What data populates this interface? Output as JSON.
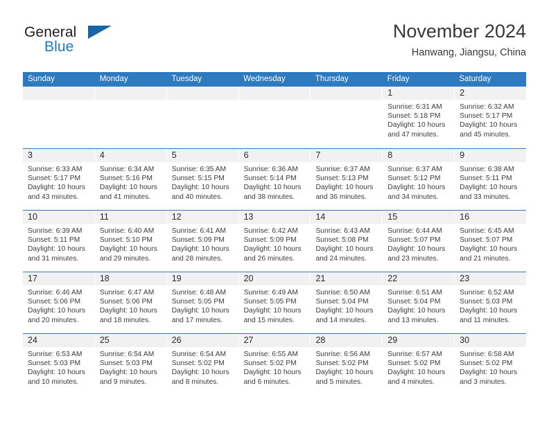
{
  "brand": {
    "word1": "General",
    "word2": "Blue",
    "flag_icon": "triangle-flag-icon",
    "color_dark": "#1c1c1c",
    "color_blue": "#1f78c1",
    "flag_color": "#1565a8"
  },
  "header": {
    "title": "November 2024",
    "subtitle": "Hanwang, Jiangsu, China"
  },
  "theme": {
    "header_bg": "#2d7ac0",
    "daynum_bg": "#f1f1f1",
    "text": "#3a3b3d"
  },
  "weekdays": [
    "Sunday",
    "Monday",
    "Tuesday",
    "Wednesday",
    "Thursday",
    "Friday",
    "Saturday"
  ],
  "weeks": [
    [
      {
        "day": "",
        "lines": []
      },
      {
        "day": "",
        "lines": []
      },
      {
        "day": "",
        "lines": []
      },
      {
        "day": "",
        "lines": []
      },
      {
        "day": "",
        "lines": []
      },
      {
        "day": "1",
        "lines": [
          "Sunrise: 6:31 AM",
          "Sunset: 5:18 PM",
          "Daylight: 10 hours",
          "and 47 minutes."
        ]
      },
      {
        "day": "2",
        "lines": [
          "Sunrise: 6:32 AM",
          "Sunset: 5:17 PM",
          "Daylight: 10 hours",
          "and 45 minutes."
        ]
      }
    ],
    [
      {
        "day": "3",
        "lines": [
          "Sunrise: 6:33 AM",
          "Sunset: 5:17 PM",
          "Daylight: 10 hours",
          "and 43 minutes."
        ]
      },
      {
        "day": "4",
        "lines": [
          "Sunrise: 6:34 AM",
          "Sunset: 5:16 PM",
          "Daylight: 10 hours",
          "and 41 minutes."
        ]
      },
      {
        "day": "5",
        "lines": [
          "Sunrise: 6:35 AM",
          "Sunset: 5:15 PM",
          "Daylight: 10 hours",
          "and 40 minutes."
        ]
      },
      {
        "day": "6",
        "lines": [
          "Sunrise: 6:36 AM",
          "Sunset: 5:14 PM",
          "Daylight: 10 hours",
          "and 38 minutes."
        ]
      },
      {
        "day": "7",
        "lines": [
          "Sunrise: 6:37 AM",
          "Sunset: 5:13 PM",
          "Daylight: 10 hours",
          "and 36 minutes."
        ]
      },
      {
        "day": "8",
        "lines": [
          "Sunrise: 6:37 AM",
          "Sunset: 5:12 PM",
          "Daylight: 10 hours",
          "and 34 minutes."
        ]
      },
      {
        "day": "9",
        "lines": [
          "Sunrise: 6:38 AM",
          "Sunset: 5:11 PM",
          "Daylight: 10 hours",
          "and 33 minutes."
        ]
      }
    ],
    [
      {
        "day": "10",
        "lines": [
          "Sunrise: 6:39 AM",
          "Sunset: 5:11 PM",
          "Daylight: 10 hours",
          "and 31 minutes."
        ]
      },
      {
        "day": "11",
        "lines": [
          "Sunrise: 6:40 AM",
          "Sunset: 5:10 PM",
          "Daylight: 10 hours",
          "and 29 minutes."
        ]
      },
      {
        "day": "12",
        "lines": [
          "Sunrise: 6:41 AM",
          "Sunset: 5:09 PM",
          "Daylight: 10 hours",
          "and 28 minutes."
        ]
      },
      {
        "day": "13",
        "lines": [
          "Sunrise: 6:42 AM",
          "Sunset: 5:09 PM",
          "Daylight: 10 hours",
          "and 26 minutes."
        ]
      },
      {
        "day": "14",
        "lines": [
          "Sunrise: 6:43 AM",
          "Sunset: 5:08 PM",
          "Daylight: 10 hours",
          "and 24 minutes."
        ]
      },
      {
        "day": "15",
        "lines": [
          "Sunrise: 6:44 AM",
          "Sunset: 5:07 PM",
          "Daylight: 10 hours",
          "and 23 minutes."
        ]
      },
      {
        "day": "16",
        "lines": [
          "Sunrise: 6:45 AM",
          "Sunset: 5:07 PM",
          "Daylight: 10 hours",
          "and 21 minutes."
        ]
      }
    ],
    [
      {
        "day": "17",
        "lines": [
          "Sunrise: 6:46 AM",
          "Sunset: 5:06 PM",
          "Daylight: 10 hours",
          "and 20 minutes."
        ]
      },
      {
        "day": "18",
        "lines": [
          "Sunrise: 6:47 AM",
          "Sunset: 5:06 PM",
          "Daylight: 10 hours",
          "and 18 minutes."
        ]
      },
      {
        "day": "19",
        "lines": [
          "Sunrise: 6:48 AM",
          "Sunset: 5:05 PM",
          "Daylight: 10 hours",
          "and 17 minutes."
        ]
      },
      {
        "day": "20",
        "lines": [
          "Sunrise: 6:49 AM",
          "Sunset: 5:05 PM",
          "Daylight: 10 hours",
          "and 15 minutes."
        ]
      },
      {
        "day": "21",
        "lines": [
          "Sunrise: 6:50 AM",
          "Sunset: 5:04 PM",
          "Daylight: 10 hours",
          "and 14 minutes."
        ]
      },
      {
        "day": "22",
        "lines": [
          "Sunrise: 6:51 AM",
          "Sunset: 5:04 PM",
          "Daylight: 10 hours",
          "and 13 minutes."
        ]
      },
      {
        "day": "23",
        "lines": [
          "Sunrise: 6:52 AM",
          "Sunset: 5:03 PM",
          "Daylight: 10 hours",
          "and 11 minutes."
        ]
      }
    ],
    [
      {
        "day": "24",
        "lines": [
          "Sunrise: 6:53 AM",
          "Sunset: 5:03 PM",
          "Daylight: 10 hours",
          "and 10 minutes."
        ]
      },
      {
        "day": "25",
        "lines": [
          "Sunrise: 6:54 AM",
          "Sunset: 5:03 PM",
          "Daylight: 10 hours",
          "and 9 minutes."
        ]
      },
      {
        "day": "26",
        "lines": [
          "Sunrise: 6:54 AM",
          "Sunset: 5:02 PM",
          "Daylight: 10 hours",
          "and 8 minutes."
        ]
      },
      {
        "day": "27",
        "lines": [
          "Sunrise: 6:55 AM",
          "Sunset: 5:02 PM",
          "Daylight: 10 hours",
          "and 6 minutes."
        ]
      },
      {
        "day": "28",
        "lines": [
          "Sunrise: 6:56 AM",
          "Sunset: 5:02 PM",
          "Daylight: 10 hours",
          "and 5 minutes."
        ]
      },
      {
        "day": "29",
        "lines": [
          "Sunrise: 6:57 AM",
          "Sunset: 5:02 PM",
          "Daylight: 10 hours",
          "and 4 minutes."
        ]
      },
      {
        "day": "30",
        "lines": [
          "Sunrise: 6:58 AM",
          "Sunset: 5:02 PM",
          "Daylight: 10 hours",
          "and 3 minutes."
        ]
      }
    ]
  ]
}
